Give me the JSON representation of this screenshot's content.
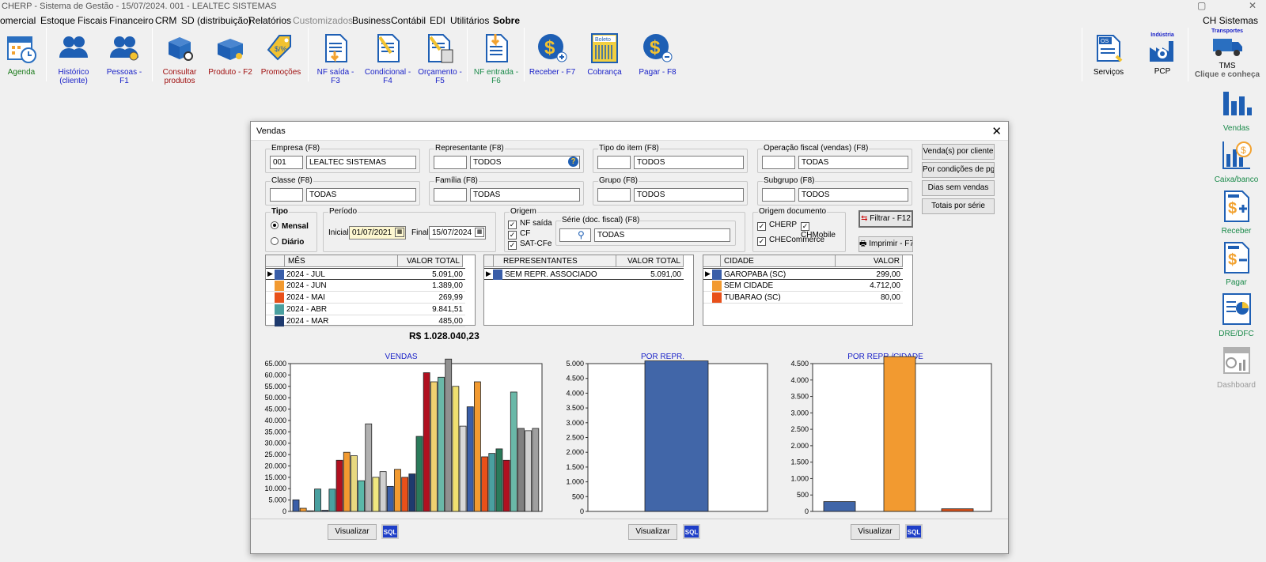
{
  "titlebar": {
    "title": "CHERP - Sistema de Gestão - 15/07/2024.  001 - LEALTEC SISTEMAS"
  },
  "menu": {
    "items": [
      "omercial",
      "Estoque",
      "Fiscais",
      "Financeiro",
      "CRM",
      "SD (distribuição)",
      "Relatórios",
      "Customizados",
      "Business",
      "Contábil",
      "EDI",
      "Utilitários",
      "Sobre"
    ],
    "right": "CH Sistemas"
  },
  "toolbar": {
    "agenda": "Agenda",
    "historico": "Histórico (cliente)",
    "pessoas": "Pessoas - F1",
    "consultar": "Consultar produtos",
    "produto": "Produto - F2",
    "promocoes": "Promoções",
    "nfsaida": "NF saída - F3",
    "condicional": "Condicional - F4",
    "orcamento": "Orçamento - F5",
    "nfentrada": "NF entrada - F6",
    "receber": "Receber - F7",
    "cobranca": "Cobrança",
    "pagar": "Pagar - F8",
    "servicos": "Serviços",
    "pcp": "PCP",
    "industria": "Indústria",
    "transportes": "Transportes",
    "tms": "TMS",
    "clique": "Clique e conheça",
    "os": "OS",
    "boleto": "Boleto"
  },
  "sidebar": {
    "vendas": "Vendas",
    "caixa": "Caixa/banco",
    "receber": "Receber",
    "pagar": "Pagar",
    "dre": "DRE/DFC",
    "dashboard": "Dashboard"
  },
  "window": {
    "title": "Vendas",
    "close": "✕"
  },
  "filters": {
    "empresa": {
      "label": "Empresa (F8)",
      "code": "001",
      "name": "LEALTEC SISTEMAS"
    },
    "representante": {
      "label": "Representante (F8)",
      "code": "",
      "name": "TODOS"
    },
    "tipoitem": {
      "label": "Tipo do item (F8)",
      "code": "",
      "name": "TODOS"
    },
    "operacao": {
      "label": "Operação fiscal (vendas) (F8)",
      "code": "",
      "name": "TODAS"
    },
    "classe": {
      "label": "Classe (F8)",
      "code": "",
      "name": "TODAS"
    },
    "familia": {
      "label": "Família (F8)",
      "code": "",
      "name": "TODAS"
    },
    "grupo": {
      "label": "Grupo (F8)",
      "code": "",
      "name": "TODOS"
    },
    "subgrupo": {
      "label": "Subgrupo (F8)",
      "code": "",
      "name": "TODOS"
    }
  },
  "tipo": {
    "label": "Tipo",
    "mensal": "Mensal",
    "diario": "Diário"
  },
  "periodo": {
    "label": "Período",
    "inicial_label": "Inicial",
    "inicial": "01/07/2021",
    "final_label": "Final",
    "final": "15/07/2024"
  },
  "origem": {
    "label": "Origem",
    "nf": "NF saída",
    "cf": "CF",
    "sat": "SAT-CFe",
    "serie_label": "Série (doc. fiscal) (F8)",
    "serie": "TODAS"
  },
  "origemdoc": {
    "label": "Origem documento",
    "cherp": "CHERP",
    "chmobile": "CHMobile",
    "checommerce": "CHECommerce"
  },
  "buttons": {
    "porcliente": "Venda(s) por cliente",
    "porcond": "Por condições de pgto",
    "diassem": "Dias sem vendas",
    "totais": "Totais por série",
    "filtrar": "Filtrar - F12",
    "imprimir": "Imprimir - F7",
    "visualizar": "Visualizar",
    "sql": "SQL"
  },
  "grid_mes": {
    "col1": "MÊS",
    "col2": "VALOR TOTAL",
    "rows": [
      {
        "mes": "2024 - JUL",
        "valor": "5.091,00",
        "color": "#3a5ea8"
      },
      {
        "mes": "2024 - JUN",
        "valor": "1.389,00",
        "color": "#f29a30"
      },
      {
        "mes": "2024 - MAI",
        "valor": "269,99",
        "color": "#e8501a"
      },
      {
        "mes": "2024 - ABR",
        "valor": "9.841,51",
        "color": "#4aa0a0"
      },
      {
        "mes": "2024 - MAR",
        "valor": "485,00",
        "color": "#1e3a6e"
      }
    ]
  },
  "total": "R$ 1.028.040,23",
  "grid_rep": {
    "col1": "REPRESENTANTES",
    "col2": "VALOR TOTAL",
    "rows": [
      {
        "nome": "SEM REPR. ASSOCIADO",
        "valor": "5.091,00",
        "color": "#3a5ea8"
      }
    ]
  },
  "grid_cid": {
    "col1": "CIDADE",
    "col2": "VALOR",
    "rows": [
      {
        "nome": "GAROPABA (SC)",
        "valor": "299,00",
        "color": "#3a5ea8"
      },
      {
        "nome": "SEM CIDADE",
        "valor": "4.712,00",
        "color": "#f29a30"
      },
      {
        "nome": "TUBARAO (SC)",
        "valor": "80,00",
        "color": "#e8501a"
      }
    ]
  },
  "chart_data": [
    {
      "type": "bar",
      "title": "VENDAS",
      "ylim": [
        0,
        65000
      ],
      "ticks": [
        "0",
        "5.000",
        "10.000",
        "15.000",
        "20.000",
        "25.000",
        "30.000",
        "35.000",
        "40.000",
        "45.000",
        "50.000",
        "55.000",
        "60.000",
        "65.000"
      ],
      "values": [
        5091,
        1389,
        270,
        9842,
        485,
        9800,
        22500,
        26000,
        24500,
        13500,
        38500,
        15000,
        17500,
        11000,
        18500,
        15000,
        16500,
        33000,
        61000,
        57000,
        59000,
        67000,
        55000,
        37500,
        46000,
        57000,
        24000,
        25500,
        27500,
        22500,
        52500,
        36500,
        35500,
        36500
      ],
      "colors": [
        "#3a5ea8",
        "#f29a30",
        "#e8501a",
        "#4aa0a0",
        "#1e3a6e",
        "#4aa0a0",
        "#b01020",
        "#f29a30",
        "#e8d880",
        "#5ab8a8",
        "#b0b0b0",
        "#f0e880",
        "#d0d0d0",
        "#3a5ea8",
        "#f29a30",
        "#e8501a",
        "#1e3a6e",
        "#2a7a5a",
        "#b01020",
        "#f0d070",
        "#6ab8a8",
        "#909090",
        "#f0e070",
        "#d8d8d8",
        "#3a5ea8",
        "#f29a30",
        "#e8501a",
        "#4aa0a0",
        "#2a7a5a",
        "#b01020",
        "#6ab8a8",
        "#808080",
        "#d0d0d0",
        "#a0a0a0"
      ]
    },
    {
      "type": "bar",
      "title": "POR REPR.",
      "ylim": [
        0,
        5000
      ],
      "ticks": [
        "0",
        "500",
        "1.000",
        "1.500",
        "2.000",
        "2.500",
        "3.000",
        "3.500",
        "4.000",
        "4.500",
        "5.000"
      ],
      "categories": [
        "SEM REPR. ASSOCIADO"
      ],
      "values": [
        5091
      ],
      "colors": [
        "#4166a8"
      ]
    },
    {
      "type": "bar",
      "title": "POR REPR./CIDADE",
      "ylim": [
        0,
        4500
      ],
      "ticks": [
        "0",
        "500",
        "1.000",
        "1.500",
        "2.000",
        "2.500",
        "3.000",
        "3.500",
        "4.000",
        "4.500"
      ],
      "categories": [
        "GAROPABA (SC)",
        "SEM CIDADE",
        "TUBARAO (SC)"
      ],
      "values": [
        299,
        4712,
        80
      ],
      "colors": [
        "#4166a8",
        "#f29a30",
        "#d8501a"
      ]
    }
  ]
}
